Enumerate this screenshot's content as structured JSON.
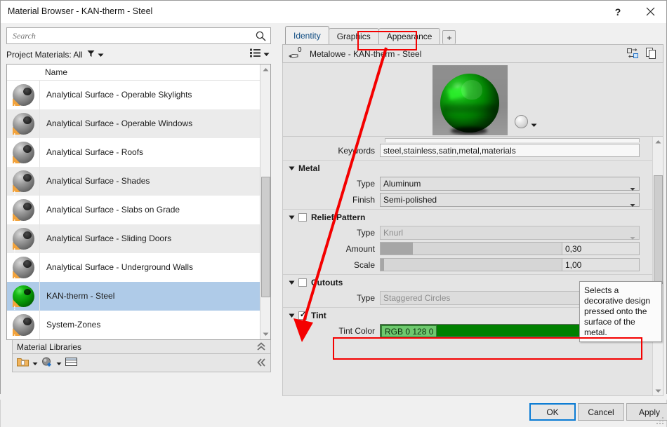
{
  "window": {
    "title": "Material Browser - KAN-therm - Steel",
    "help_glyph": "?",
    "help_icon": "help-icon",
    "close_icon": "close-icon"
  },
  "search": {
    "placeholder": "Search",
    "value": "",
    "icon": "search-icon"
  },
  "filter": {
    "label": "Project Materials: All",
    "funnel_icon": "funnel-icon",
    "caret_icon": "chevron-down-icon",
    "view_icon": "list-view-icon",
    "view_caret_icon": "chevron-down-icon"
  },
  "list": {
    "column_header": "Name",
    "items": [
      {
        "name": "Analytical Surface - Operable Skylights",
        "selected": false,
        "thumb": "grey-sphere"
      },
      {
        "name": "Analytical Surface - Operable Windows",
        "selected": false,
        "thumb": "grey-sphere"
      },
      {
        "name": "Analytical Surface - Roofs",
        "selected": false,
        "thumb": "grey-sphere"
      },
      {
        "name": "Analytical Surface - Shades",
        "selected": false,
        "thumb": "grey-sphere"
      },
      {
        "name": "Analytical Surface - Slabs on Grade",
        "selected": false,
        "thumb": "grey-sphere"
      },
      {
        "name": "Analytical Surface - Sliding Doors",
        "selected": false,
        "thumb": "grey-sphere"
      },
      {
        "name": "Analytical Surface - Underground Walls",
        "selected": false,
        "thumb": "grey-sphere"
      },
      {
        "name": "KAN-therm - Steel",
        "selected": true,
        "thumb": "green-sphere"
      },
      {
        "name": "System-Zones",
        "selected": false,
        "thumb": "grey-sphere"
      }
    ]
  },
  "libraries": {
    "title": "Material Libraries",
    "collapse_icon": "double-chevron-up-icon",
    "tools": [
      {
        "icon": "open-library-icon",
        "caret": true
      },
      {
        "icon": "new-material-icon",
        "caret": true
      },
      {
        "icon": "library-panel-icon",
        "caret": false
      }
    ],
    "expand_icon": "double-chevron-left-icon"
  },
  "tabs": [
    {
      "label": "Identity",
      "active": true
    },
    {
      "label": "Graphics",
      "active": false
    },
    {
      "label": "Appearance",
      "active": false,
      "highlighted": true
    }
  ],
  "tab_add": {
    "label": "+"
  },
  "asset": {
    "badge": "0",
    "icon": "asset-hand-icon",
    "name": "Metalowe - KAN-therm - Steel",
    "replace_icon": "replace-asset-icon",
    "duplicate_icon": "duplicate-asset-icon"
  },
  "preview": {
    "swatch_icon": "sphere-preview-icon",
    "caret_icon": "chevron-down-icon",
    "scene_color": "#8f8f8f",
    "ball_color": "#0ea60e"
  },
  "properties": {
    "keywords": {
      "label": "Keywords",
      "value": "steel,stainless,satin,metal,materials"
    },
    "metal": {
      "title": "Metal",
      "tri_icon": "triangle-down-icon",
      "type": {
        "label": "Type",
        "value": "Aluminum"
      },
      "finish": {
        "label": "Finish",
        "value": "Semi-polished"
      }
    },
    "relief": {
      "title": "Relief Pattern",
      "checked": false,
      "tri_icon": "triangle-down-icon",
      "type": {
        "label": "Type",
        "value": "Knurl"
      },
      "amount": {
        "label": "Amount",
        "value": "0,30",
        "fill_percent": 18
      },
      "scale": {
        "label": "Scale",
        "value": "1,00",
        "fill_percent": 2
      }
    },
    "cutouts": {
      "title": "Cutouts",
      "checked": false,
      "tri_icon": "triangle-down-icon",
      "type": {
        "label": "Type",
        "value": "Staggered Circles"
      }
    },
    "tint": {
      "title": "Tint",
      "checked": true,
      "tri_icon": "triangle-down-icon",
      "color": {
        "label": "Tint Color",
        "value": "RGB 0 128 0",
        "hex": "#008000"
      }
    }
  },
  "tooltip": {
    "text": "Selects a decorative design pressed onto the surface of the metal."
  },
  "footer": {
    "ok": "OK",
    "cancel": "Cancel",
    "apply": "Apply"
  },
  "annotations": {
    "accent_color": "#f40000",
    "box_tab": "appearance-tab-highlight",
    "box_tint": "tint-color-highlight",
    "arrow": "red-arrow-pointer"
  }
}
